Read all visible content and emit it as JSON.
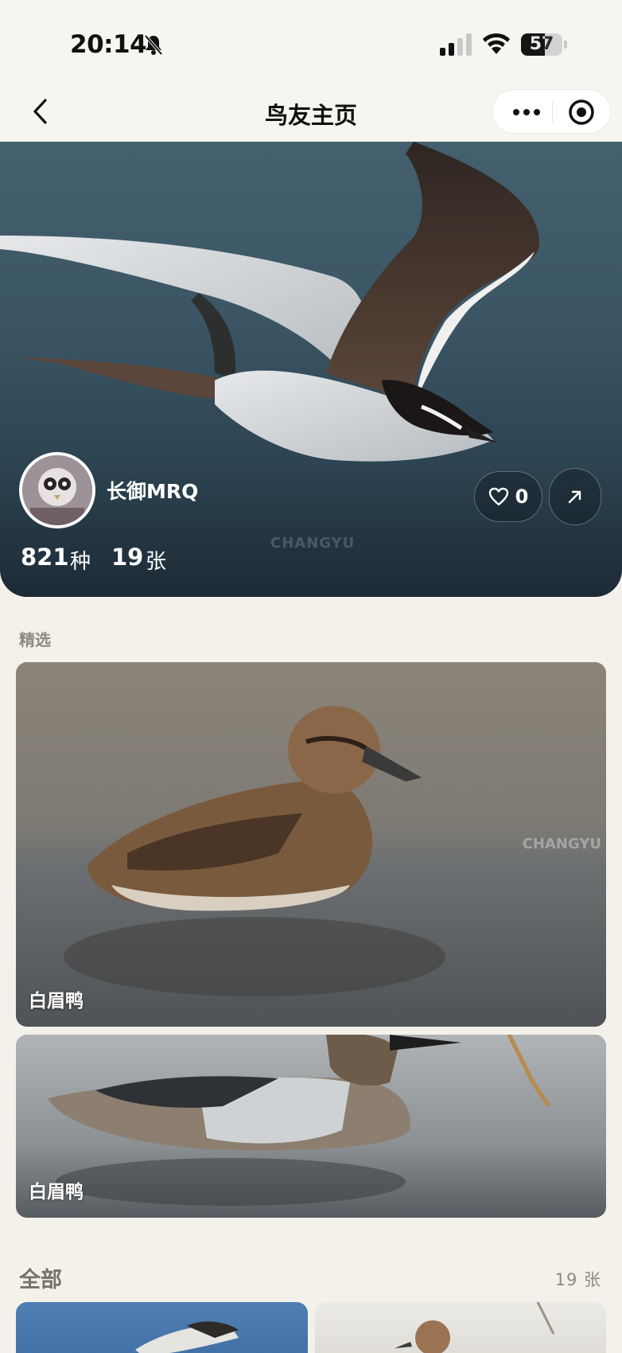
{
  "status_bar": {
    "time": "20:14",
    "battery": "57",
    "battery_level_percent": 57
  },
  "nav": {
    "title": "鸟友主页"
  },
  "profile": {
    "name": "长御MRQ",
    "species_count": "821",
    "species_unit": "种",
    "photo_count": "19",
    "photo_unit": "张",
    "likes": "0",
    "hero_watermark": "CHANGYU"
  },
  "featured": {
    "label": "精选",
    "photos": [
      {
        "caption": "白眉鸭",
        "watermark": "CHANGYU"
      },
      {
        "caption": "白眉鸭"
      }
    ]
  },
  "all": {
    "label": "全部",
    "count": "19 张"
  },
  "colors": {
    "page_bg": "#f4f1ea",
    "hero_sky": "#3b5564",
    "text_muted": "#8e8a80"
  },
  "icons": [
    "bell-off-icon",
    "signal-icon",
    "wifi-icon",
    "battery-icon",
    "back-chevron-icon",
    "more-dots-icon",
    "target-icon",
    "heart-icon",
    "share-arrow-icon"
  ]
}
